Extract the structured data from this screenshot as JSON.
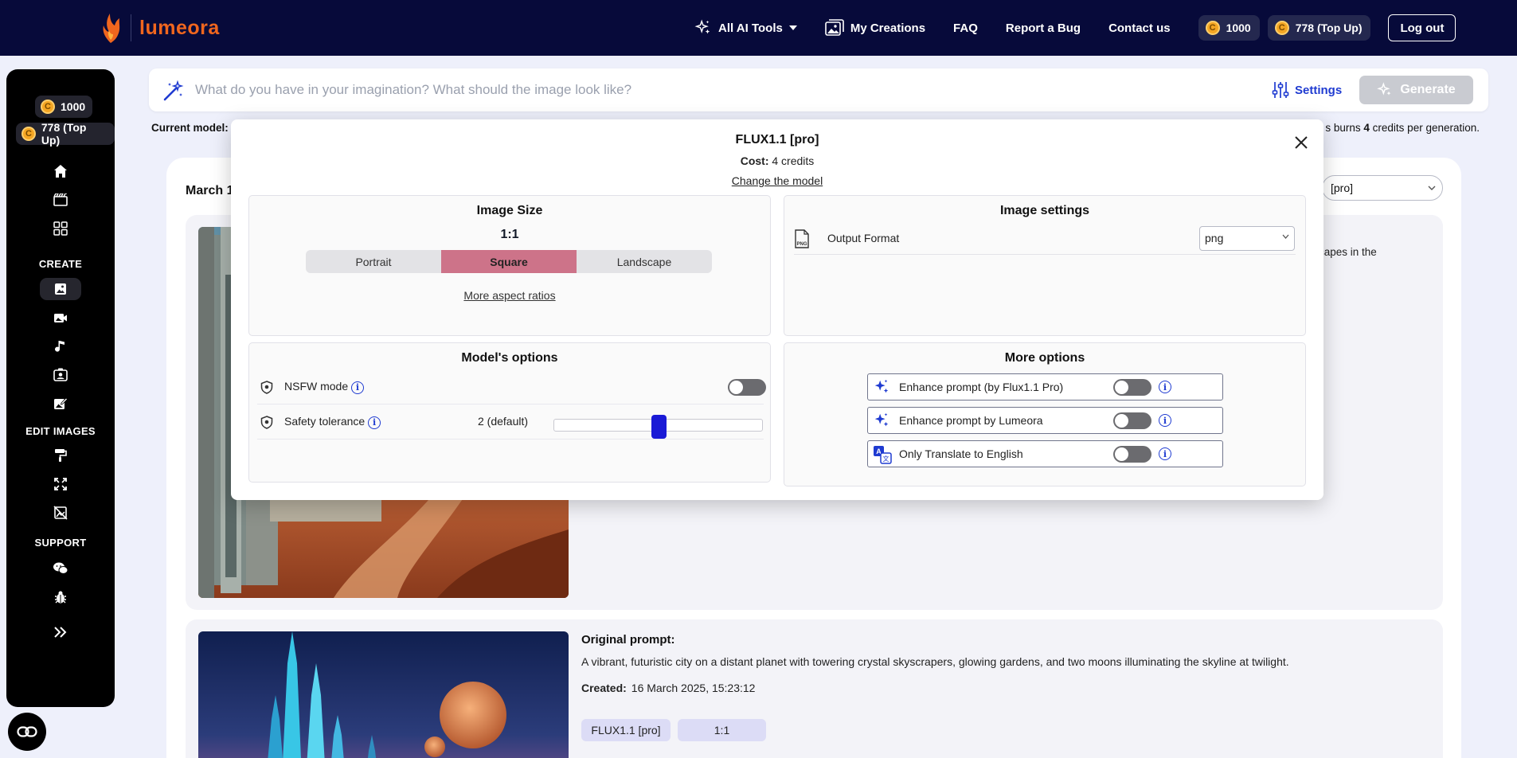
{
  "brand": {
    "name": "lumeora"
  },
  "nav": {
    "items": [
      {
        "label": "All AI Tools",
        "icon": "sparkles-icon",
        "has_dropdown": true
      },
      {
        "label": "My Creations",
        "icon": "gallery-icon"
      },
      {
        "label": "FAQ"
      },
      {
        "label": "Report a Bug"
      },
      {
        "label": "Contact us"
      }
    ],
    "credits": "1000",
    "topup_credits": "778 (Top Up)",
    "logout_label": "Log out"
  },
  "sidebar": {
    "credits": "1000",
    "topup_credits": "778 (Top Up)",
    "sections": {
      "create": "CREATE",
      "edit_images": "EDIT IMAGES",
      "support": "SUPPORT"
    },
    "icons": [
      "home-icon",
      "film-icon",
      "grid-icon",
      "image-icon",
      "video-icon",
      "music-icon",
      "portrait-icon",
      "image-edit-icon",
      "paint-roller-icon",
      "expand-icon",
      "remove-background-icon",
      "chat-icon",
      "bug-icon",
      "chevron-double-right-icon"
    ]
  },
  "prompt": {
    "placeholder": "What do you have in your imagination? What should the image look like?",
    "settings_label": "Settings",
    "generate_label": "Generate"
  },
  "current_model": {
    "label": "Current model:",
    "burns_prefix": "s burns",
    "burns_count": "4",
    "burns_suffix": "credits per generation."
  },
  "gallery": {
    "date_heading": "March 1",
    "model_select_value": "[pro]",
    "fragment_text": "capes in the",
    "card2": {
      "title": "Original prompt:",
      "prompt": "A vibrant, futuristic city on a distant planet with towering crystal skyscrapers, glowing gardens, and two moons illuminating the skyline at twilight.",
      "created_label": "Created:",
      "created_value": "16 March 2025, 15:23:12",
      "tags": [
        "FLUX1.1 [pro]",
        "1:1"
      ]
    }
  },
  "modal": {
    "title": "FLUX1.1 [pro]",
    "cost_label": "Cost:",
    "cost_value": "4 credits",
    "change_model": "Change the model",
    "image_size": {
      "title": "Image Size",
      "ratio": "1:1",
      "options": [
        "Portrait",
        "Square",
        "Landscape"
      ],
      "selected": "Square",
      "more_link": "More aspect ratios"
    },
    "image_settings": {
      "title": "Image settings",
      "output_format_label": "Output Format",
      "output_format_value": "png"
    },
    "model_options": {
      "title": "Model's options",
      "nsfw_label": "NSFW mode",
      "nsfw_on": false,
      "safety_label": "Safety tolerance",
      "safety_value": "2 (default)",
      "safety_level_fraction": 0.5
    },
    "more_options": {
      "title": "More options",
      "items": [
        {
          "label": "Enhance prompt (by Flux1.1 Pro)",
          "icon": "sparkles-icon",
          "on": false
        },
        {
          "label": "Enhance prompt by Lumeora",
          "icon": "sparkles-icon",
          "on": false
        },
        {
          "label": "Only Translate to English",
          "icon": "translate-icon",
          "on": false
        }
      ]
    }
  },
  "colors": {
    "nav_bg": "#070a3a",
    "accent_blue": "#1f3bd1",
    "brand_orange": "#f0661e",
    "segment_selected": "#cd7389"
  }
}
